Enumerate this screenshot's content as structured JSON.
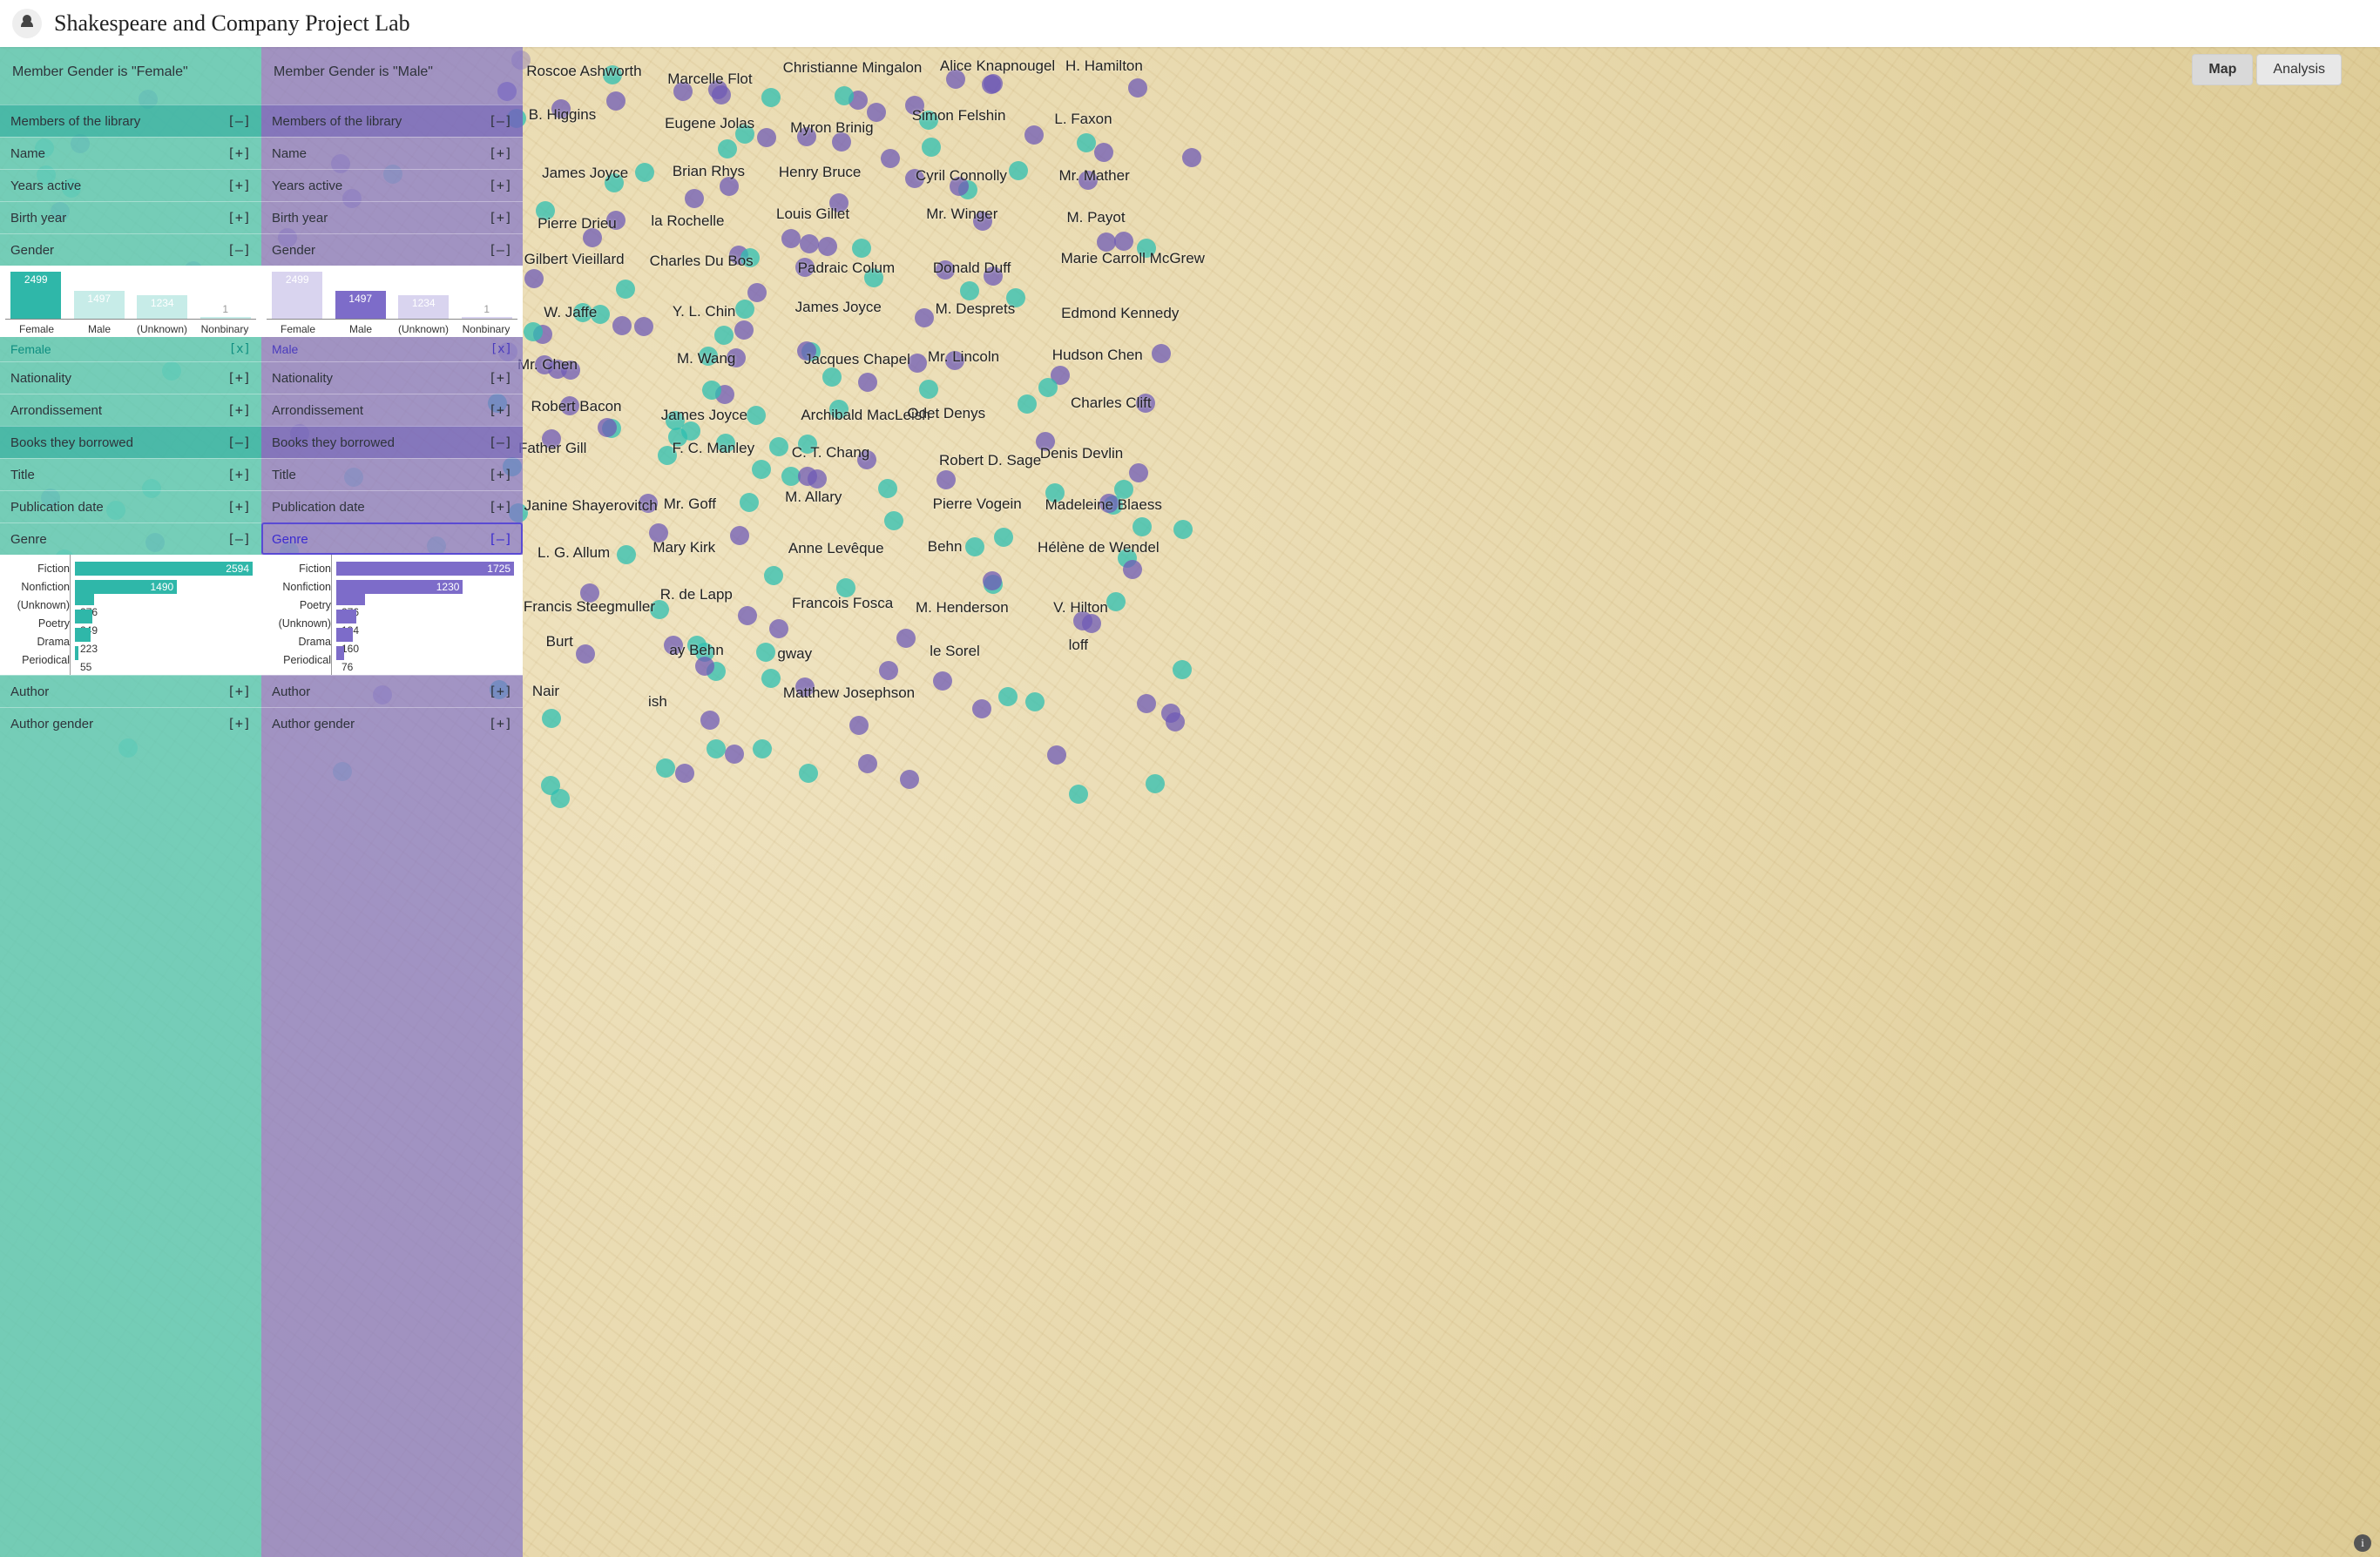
{
  "header": {
    "title": "Shakespeare and Company Project Lab"
  },
  "view_toggle": {
    "map": "Map",
    "analysis": "Analysis",
    "active": "map"
  },
  "panels": [
    {
      "theme": "teal",
      "title": "Member Gender is \"Female\"",
      "filter": {
        "label": "Female",
        "clear": "[x]"
      },
      "genre_max": 2594
    },
    {
      "theme": "purple",
      "title": "Member Gender is \"Male\"",
      "filter": {
        "label": "Male",
        "clear": "[x]"
      },
      "genre_max": 1725
    }
  ],
  "sections": {
    "members_head": "Members of the library",
    "name": "Name",
    "years": "Years active",
    "birth": "Birth year",
    "gender": "Gender",
    "nationality": "Nationality",
    "arr": "Arrondissement",
    "books_head": "Books they borrowed",
    "title_f": "Title",
    "pub": "Publication date",
    "genre": "Genre",
    "author": "Author",
    "author_gender": "Author gender"
  },
  "toggles": {
    "expand": "[+]",
    "collapse": "[–]"
  },
  "chart_data": [
    {
      "type": "bar",
      "orientation": "vertical",
      "panel": "Female – Gender",
      "categories": [
        "Female",
        "Male",
        "(Unknown)",
        "Nonbinary"
      ],
      "values": [
        2499,
        1497,
        1234,
        1
      ],
      "selected_index": 0,
      "ylim": [
        0,
        2600
      ]
    },
    {
      "type": "bar",
      "orientation": "vertical",
      "panel": "Male – Gender",
      "categories": [
        "Female",
        "Male",
        "(Unknown)",
        "Nonbinary"
      ],
      "values": [
        2499,
        1497,
        1234,
        1
      ],
      "selected_index": 1,
      "ylim": [
        0,
        2600
      ]
    },
    {
      "type": "bar",
      "orientation": "horizontal",
      "panel": "Female – Genre",
      "categories": [
        "Fiction",
        "Nonfiction",
        "(Unknown)",
        "Poetry",
        "Drama",
        "Periodical"
      ],
      "values": [
        2594,
        1490,
        276,
        249,
        223,
        55
      ],
      "xlim": [
        0,
        2700
      ]
    },
    {
      "type": "bar",
      "orientation": "horizontal",
      "panel": "Male – Genre",
      "categories": [
        "Fiction",
        "Nonfiction",
        "Poetry",
        "(Unknown)",
        "Drama",
        "Periodical"
      ],
      "values": [
        1725,
        1230,
        276,
        194,
        160,
        76
      ],
      "xlim": [
        0,
        1800
      ]
    }
  ],
  "map_names": [
    "Roscoe Ashworth",
    "Marcelle Flot",
    "Christianne Mingalon",
    "Alice Knapnougel",
    "H. Hamilton",
    "B. Higgins",
    "Eugene Jolas",
    "Myron Brinig",
    "Simon Felshin",
    "L. Faxon",
    "James Joyce",
    "Brian Rhys",
    "Henry Bruce",
    "Cyril Connolly",
    "Mr. Mather",
    "Pierre Drieu",
    "la Rochelle",
    "Louis Gillet",
    "Mr. Winger",
    "M. Payot",
    "Gilbert Vieillard",
    "Charles Du Bos",
    "Padraic Colum",
    "Donald Duff",
    "Marie Carroll McGrew",
    "W. Jaffe",
    "Y. L. Chin",
    "James Joyce",
    "M. Desprets",
    "Edmond Kennedy",
    "Mr. Chen",
    "M. Wang",
    "Jacques Chapel",
    "Mr. Lincoln",
    "Hudson Chen",
    "Robert Bacon",
    "James Joyce",
    "Archibald MacLeish",
    "Odet Denys",
    "Charles Clift",
    "Father Gill",
    "F. C. Manley",
    "C. T. Chang",
    "Robert D. Sage",
    "Denis Devlin",
    "Janine Shayerovitch",
    "Mr. Goff",
    "M. Allary",
    "Pierre Vogein",
    "Madeleine Blaess",
    "L. G. Allum",
    "Mary Kirk",
    "Anne Levêque",
    "Behn",
    "Hélène de Wendel",
    "Francis Steegmuller",
    "R. de Lapp",
    "Francois Fosca",
    "M. Henderson",
    "V. Hilton",
    "Burt",
    "ay Behn",
    "gway",
    "le Sorel",
    "loff",
    "Nair",
    "ish",
    "Matthew Josephson"
  ]
}
